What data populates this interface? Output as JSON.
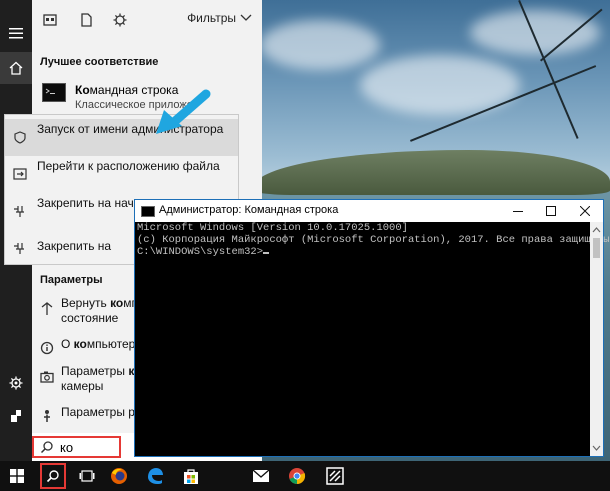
{
  "start_menu": {
    "filters_label": "Фильтры",
    "best_match_title": "Лучшее соответствие",
    "best_match": {
      "name_bold": "Ко",
      "name_rest": "мандная строка",
      "subtitle": "Классическое приложе"
    },
    "context_menu": [
      {
        "label": "Запуск от имени администратора",
        "icon": "admin-shield-icon",
        "highlighted": true
      },
      {
        "label": "Перейти к расположению файла",
        "icon": "folder-open-icon"
      },
      {
        "label": "Закрепить на начальном экране",
        "icon": "pin-icon"
      },
      {
        "label": "Закрепить на",
        "icon": "pin-icon"
      }
    ],
    "params_title": "Параметры",
    "params": [
      {
        "label_pre": "Вернуть ",
        "label_bold": "ко",
        "label_post": "мпь",
        "label_line2": "состояние",
        "icon": "restore-icon"
      },
      {
        "label_pre": "О ",
        "label_bold": "ко",
        "label_post": "мпьютере",
        "label_line2": "",
        "icon": "info-icon"
      },
      {
        "label_pre": "Параметры ",
        "label_bold": "ко",
        "label_post": "",
        "label_line2": "камеры",
        "icon": "camera-icon"
      },
      {
        "label_pre": "Параметры ре",
        "label_bold": "",
        "label_post": "",
        "label_line2": "",
        "icon": "person-icon"
      }
    ],
    "search_value": "ко"
  },
  "cmd_window": {
    "title": "Администратор: Командная строка",
    "lines": [
      "Microsoft Windows [Version 10.0.17025.1000]",
      "(c) Корпорация Майкрософт (Microsoft Corporation), 2017. Все права защищены.",
      "",
      "C:\\WINDOWS\\system32>"
    ]
  },
  "taskbar_icons": [
    "windows-start-icon",
    "search-icon",
    "task-view-icon",
    "firefox-icon",
    "edge-icon",
    "store-icon",
    "mail-icon",
    "chrome-icon",
    "app-icon"
  ],
  "colors": {
    "highlight_border": "#e53935",
    "arrow": "#1fa6e0",
    "accent": "#1d6fb7"
  }
}
